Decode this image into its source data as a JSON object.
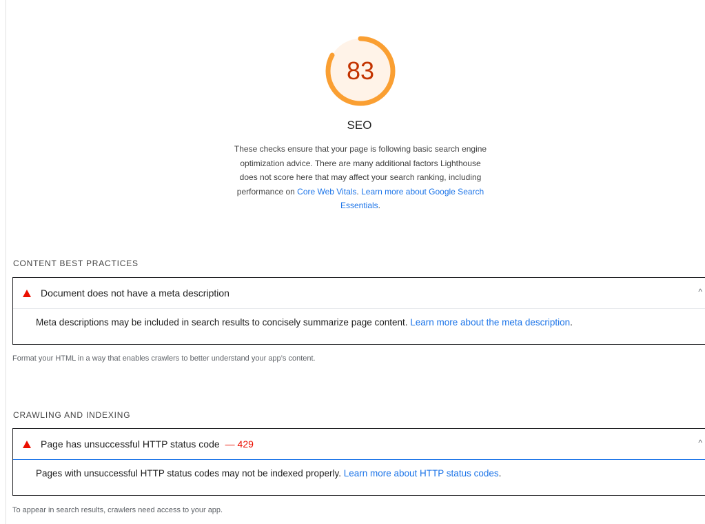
{
  "score": {
    "value": "83",
    "fraction": 0.83,
    "ring_color": "#fa9f32",
    "text_color": "#c33300",
    "fill_color": "#fff3e8"
  },
  "category": {
    "title": "SEO",
    "description_lines": [
      "These checks ensure that your page is following basic search engine",
      "optimization advice. There are many additional factors Lighthouse",
      "does not score here that may affect your search ranking, including"
    ],
    "line4_prefix": "performance on ",
    "core_web_vitals_link": "Core Web Vitals",
    "line4_sep": ". ",
    "learn_more_link_part1": "Learn more about Google Search",
    "learn_more_link_part2": "Essentials",
    "trailing": "."
  },
  "groups": [
    {
      "title": "CONTENT BEST PRACTICES",
      "audit": {
        "icon": "fail-triangle-icon",
        "title": "Document does not have a meta description",
        "display_value": "",
        "description": "Meta descriptions may be included in search results to concisely summarize page content. ",
        "link": "Learn more about the meta description",
        "trailing": "."
      },
      "description": "Format your HTML in a way that enables crawlers to better understand your app’s content."
    },
    {
      "title": "CRAWLING AND INDEXING",
      "audit": {
        "icon": "fail-triangle-icon",
        "title": "Page has unsuccessful HTTP status code",
        "display_value": "— 429",
        "description": "Pages with unsuccessful HTTP status codes may not be indexed properly. ",
        "link": "Learn more about HTTP status codes",
        "trailing": "."
      },
      "description": "To appear in search results, crawlers need access to your app."
    }
  ],
  "colors": {
    "fail": "#eb0f00",
    "link": "#1a73e8"
  }
}
